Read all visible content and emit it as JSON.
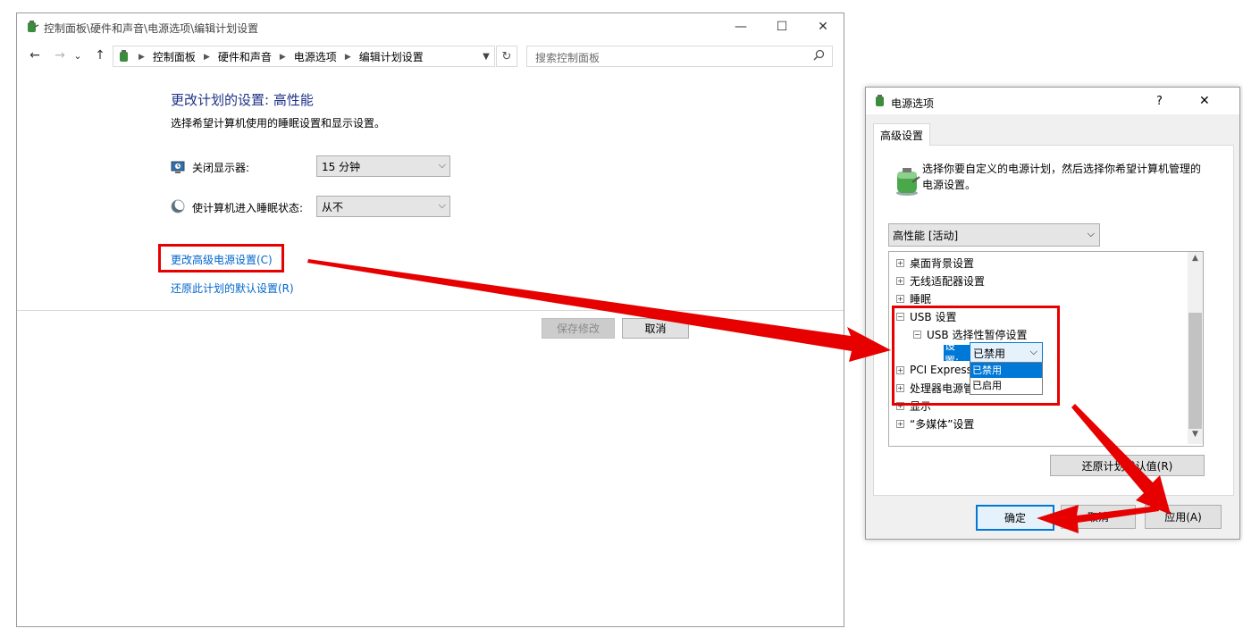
{
  "control_panel": {
    "window_title": "控制面板\\硬件和声音\\电源选项\\编辑计划设置",
    "window_buttons": {
      "minimize": "—",
      "maximize": "☐",
      "close": "✕"
    },
    "nav": {
      "back": "←",
      "forward": "→",
      "recent": "⌄",
      "up": "↑",
      "refresh": "↻"
    },
    "breadcrumbs": [
      "控制面板",
      "硬件和声音",
      "电源选项",
      "编辑计划设置"
    ],
    "search_placeholder": "搜索控制面板",
    "heading": "更改计划的设置: 高性能",
    "subheading": "选择希望计算机使用的睡眠设置和显示设置。",
    "display_off_label": "关闭显示器:",
    "display_off_value": "15 分钟",
    "sleep_label": "使计算机进入睡眠状态:",
    "sleep_value": "从不",
    "advanced_link": "更改高级电源设置(C)",
    "restore_link": "还原此计划的默认设置(R)",
    "save_button": "保存修改",
    "cancel_button": "取消"
  },
  "power_dialog": {
    "title": "电源选项",
    "help": "?",
    "close": "✕",
    "tab": "高级设置",
    "description": "选择你要自定义的电源计划，然后选择你希望计算机管理的电源设置。",
    "plan_value": "高性能 [活动]",
    "tree": {
      "desktop_bg": "桌面背景设置",
      "wireless": "无线适配器设置",
      "sleep": "睡眠",
      "usb": "USB 设置",
      "usb_suspend": "USB 选择性暂停设置",
      "setting_label": "设置:",
      "setting_value": "已禁用",
      "options": [
        "已禁用",
        "已启用"
      ],
      "pci": "PCI Express",
      "cpu": "处理器电源管",
      "display": "显示",
      "multimedia": "“多媒体”设置"
    },
    "expand_plus": "+",
    "expand_minus": "−",
    "restore_button": "还原计划默认值(R)",
    "ok_button": "确定",
    "cancel_button": "取消",
    "apply_button": "应用(A)"
  },
  "annotation_color": "#e60000"
}
